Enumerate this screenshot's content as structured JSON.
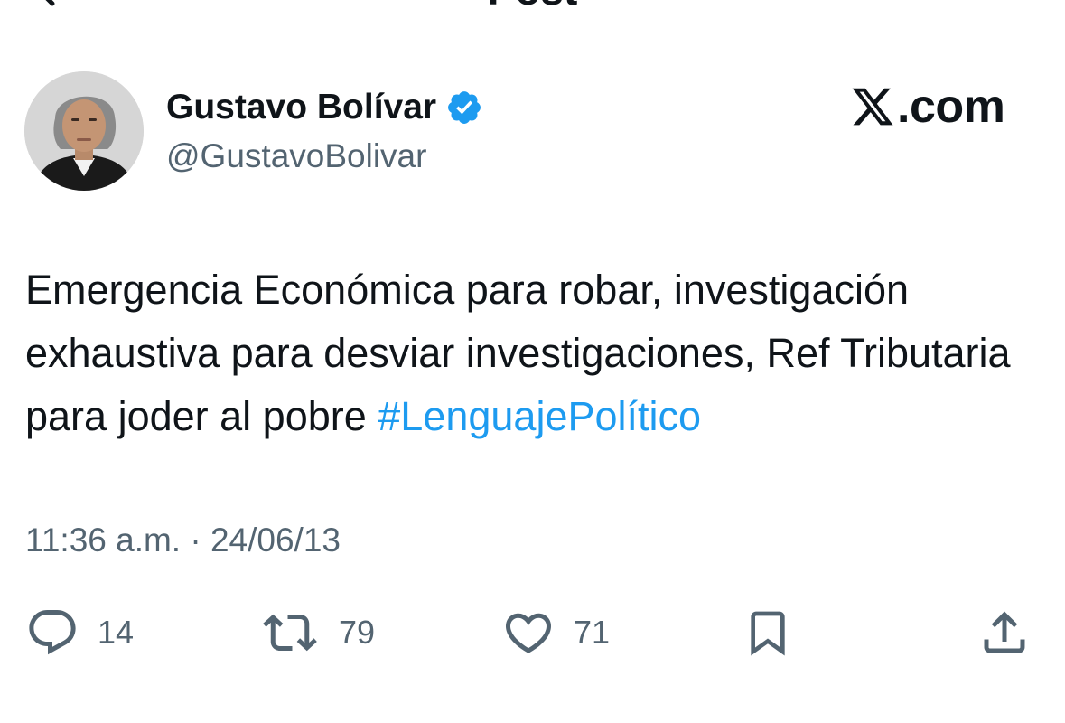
{
  "header": {
    "title": "Post"
  },
  "author": {
    "display_name": "Gustavo Bolívar",
    "handle": "@GustavoBolivar",
    "verified": true,
    "avatar_icon": "avatar-photo"
  },
  "brand": {
    "logo_icon": "x-logo-icon",
    "text": ".com"
  },
  "tweet": {
    "text": "Emergencia Económica para robar, investigación exhaustiva para desviar investigaciones, Ref Tributaria para joder al pobre ",
    "hashtag": "#LenguajePolítico",
    "timestamp": "11:36 a.m. · 24/06/13"
  },
  "actions": {
    "replies": "14",
    "retweets": "79",
    "likes": "71"
  },
  "colors": {
    "text": "#0f1419",
    "secondary": "#536471",
    "link": "#1d9bf0",
    "verified": "#1d9bf0"
  }
}
